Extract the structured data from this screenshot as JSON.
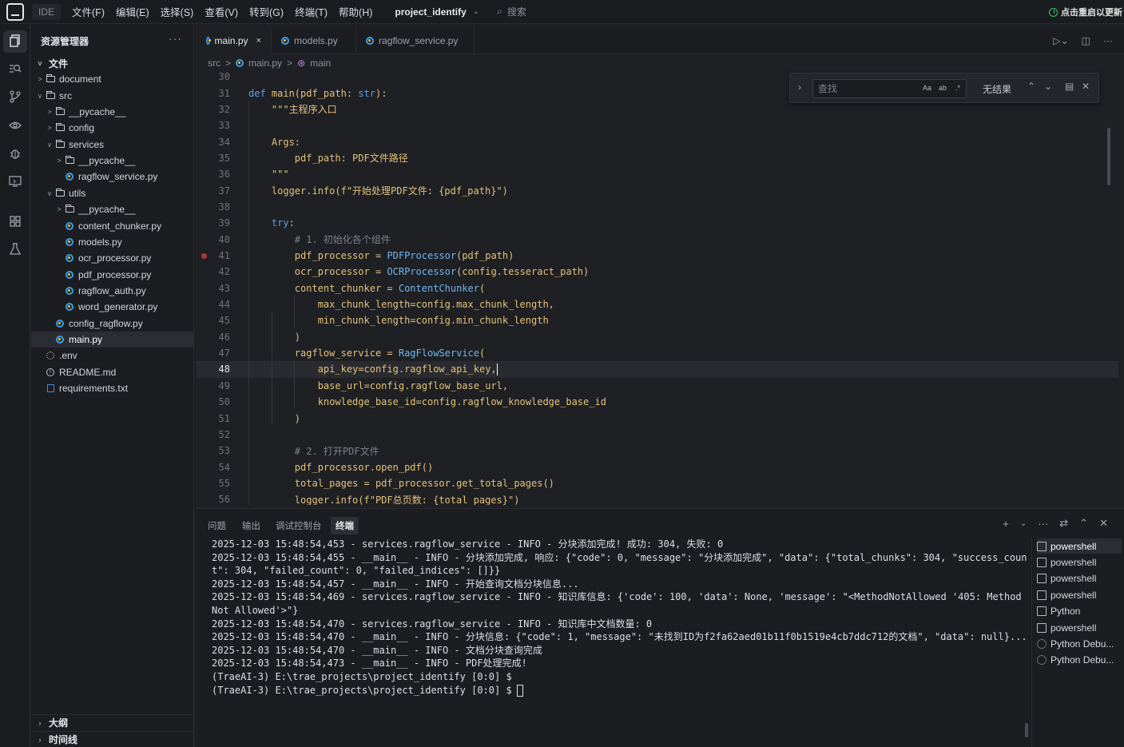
{
  "titlebar": {
    "ide_label": "IDE",
    "menus": [
      "文件(F)",
      "编辑(E)",
      "选择(S)",
      "查看(V)",
      "转到(G)",
      "终端(T)",
      "帮助(H)"
    ],
    "project": "project_identify",
    "search_placeholder": "搜索",
    "update_hint": "点击重启以更新"
  },
  "sidebar": {
    "title": "资源管理器",
    "more": "···",
    "tree": [
      {
        "label": "文件",
        "type": "section",
        "depth": 0,
        "twisty": "v"
      },
      {
        "label": "document",
        "type": "folder",
        "depth": 0,
        "twisty": ">"
      },
      {
        "label": "src",
        "type": "folder-open",
        "depth": 0,
        "twisty": "v"
      },
      {
        "label": "__pycache__",
        "type": "folder",
        "depth": 1,
        "twisty": ">"
      },
      {
        "label": "config",
        "type": "folder",
        "depth": 1,
        "twisty": ">"
      },
      {
        "label": "services",
        "type": "folder-open",
        "depth": 1,
        "twisty": "v"
      },
      {
        "label": "__pycache__",
        "type": "folder",
        "depth": 2,
        "twisty": ">"
      },
      {
        "label": "ragflow_service.py",
        "type": "py",
        "depth": 2,
        "twisty": ""
      },
      {
        "label": "utils",
        "type": "folder-open",
        "depth": 1,
        "twisty": "v"
      },
      {
        "label": "__pycache__",
        "type": "folder",
        "depth": 2,
        "twisty": ">"
      },
      {
        "label": "content_chunker.py",
        "type": "py",
        "depth": 2,
        "twisty": ""
      },
      {
        "label": "models.py",
        "type": "py",
        "depth": 2,
        "twisty": ""
      },
      {
        "label": "ocr_processor.py",
        "type": "py",
        "depth": 2,
        "twisty": ""
      },
      {
        "label": "pdf_processor.py",
        "type": "py",
        "depth": 2,
        "twisty": ""
      },
      {
        "label": "ragflow_auth.py",
        "type": "py",
        "depth": 2,
        "twisty": ""
      },
      {
        "label": "word_generator.py",
        "type": "py",
        "depth": 2,
        "twisty": ""
      },
      {
        "label": "config_ragflow.py",
        "type": "py",
        "depth": 1,
        "twisty": ""
      },
      {
        "label": "main.py",
        "type": "py",
        "depth": 1,
        "twisty": "",
        "selected": true
      },
      {
        "label": ".env",
        "type": "gear",
        "depth": 0,
        "twisty": ""
      },
      {
        "label": "README.md",
        "type": "info",
        "depth": 0,
        "twisty": ""
      },
      {
        "label": "requirements.txt",
        "type": "txt",
        "depth": 0,
        "twisty": ""
      }
    ],
    "footer": [
      "大纲",
      "时间线"
    ]
  },
  "tabs": [
    {
      "label": "main.py",
      "active": true,
      "close": "×"
    },
    {
      "label": "models.py",
      "active": false
    },
    {
      "label": "ragflow_service.py",
      "active": false
    }
  ],
  "breadcrumb": [
    "src",
    ">",
    "main.py",
    ">",
    "main"
  ],
  "find": {
    "placeholder": "查找",
    "opt_case": "Aa",
    "opt_word": "ab",
    "opt_regex": ".*",
    "result": "无结果"
  },
  "code": {
    "current_line": 48,
    "breakpoint_line": 41,
    "lines": [
      {
        "n": "30",
        "t": ""
      },
      {
        "n": "31",
        "t": "def main(pdf_path: str):"
      },
      {
        "n": "32",
        "t": "    \"\"\"主程序入口"
      },
      {
        "n": "33",
        "t": ""
      },
      {
        "n": "34",
        "t": "    Args:"
      },
      {
        "n": "35",
        "t": "        pdf_path: PDF文件路径"
      },
      {
        "n": "36",
        "t": "    \"\"\""
      },
      {
        "n": "37",
        "t": "    logger.info(f\"开始处理PDF文件: {pdf_path}\")"
      },
      {
        "n": "38",
        "t": ""
      },
      {
        "n": "39",
        "t": "    try:"
      },
      {
        "n": "40",
        "t": "        # 1. 初始化各个组件"
      },
      {
        "n": "41",
        "t": "        pdf_processor = PDFProcessor(pdf_path)"
      },
      {
        "n": "42",
        "t": "        ocr_processor = OCRProcessor(config.tesseract_path)"
      },
      {
        "n": "43",
        "t": "        content_chunker = ContentChunker("
      },
      {
        "n": "44",
        "t": "            max_chunk_length=config.max_chunk_length,"
      },
      {
        "n": "45",
        "t": "            min_chunk_length=config.min_chunk_length"
      },
      {
        "n": "46",
        "t": "        )"
      },
      {
        "n": "47",
        "t": "        ragflow_service = RagFlowService("
      },
      {
        "n": "48",
        "t": "            api_key=config.ragflow_api_key,"
      },
      {
        "n": "49",
        "t": "            base_url=config.ragflow_base_url,"
      },
      {
        "n": "50",
        "t": "            knowledge_base_id=config.ragflow_knowledge_base_id"
      },
      {
        "n": "51",
        "t": "        )"
      },
      {
        "n": "52",
        "t": ""
      },
      {
        "n": "53",
        "t": "        # 2. 打开PDF文件"
      },
      {
        "n": "54",
        "t": "        pdf_processor.open_pdf()"
      },
      {
        "n": "55",
        "t": "        total_pages = pdf_processor.get_total_pages()"
      },
      {
        "n": "56",
        "t": "        logger.info(f\"PDF总页数: {total_pages}\")"
      }
    ]
  },
  "panel": {
    "tabs": [
      "问题",
      "输出",
      "调试控制台",
      "终端"
    ],
    "active_tab": "终端",
    "terminal_lines": [
      "2025-12-03 15:48:54,453 - services.ragflow_service - INFO - 分块添加完成! 成功: 304, 失败: 0",
      "2025-12-03 15:48:54,455 - __main__ - INFO - 分块添加完成, 响应: {\"code\": 0, \"message\": \"分块添加完成\", \"data\": {\"total_chunks\": 304, \"success_count\": 304, \"failed_count\": 0, \"failed_indices\": []}}",
      "2025-12-03 15:48:54,457 - __main__ - INFO - 开始查询文档分块信息...",
      "2025-12-03 15:48:54,469 - services.ragflow_service - INFO - 知识库信息: {'code': 100, 'data': None, 'message': \"<MethodNotAllowed '405: Method Not Allowed'>\"}",
      "2025-12-03 15:48:54,470 - services.ragflow_service - INFO - 知识库中文档数量: 0",
      "2025-12-03 15:48:54,470 - __main__ - INFO - 分块信息: {\"code\": 1, \"message\": \"未找到ID为f2fa62aed01b11f0b1519e4cb7ddc712的文档\", \"data\": null}...",
      "2025-12-03 15:48:54,470 - __main__ - INFO - 文档分块查询完成",
      "2025-12-03 15:48:54,473 - __main__ - INFO - PDF处理完成!",
      "(TraeAI-3) E:\\trae_projects\\project_identify [0:0] $",
      "(TraeAI-3) E:\\trae_projects\\project_identify [0:0] $"
    ],
    "terminals": [
      {
        "label": "powershell",
        "kind": "shell",
        "active": true
      },
      {
        "label": "powershell",
        "kind": "shell"
      },
      {
        "label": "powershell",
        "kind": "shell"
      },
      {
        "label": "powershell",
        "kind": "shell"
      },
      {
        "label": "Python",
        "kind": "shell"
      },
      {
        "label": "powershell",
        "kind": "shell"
      },
      {
        "label": "Python Debu...",
        "kind": "debug"
      },
      {
        "label": "Python Debu...",
        "kind": "debug"
      }
    ]
  },
  "colors": {
    "background": "#1f2024",
    "keyword": "#5aa0e6",
    "function": "#e3c27a",
    "string": "#e3c27a",
    "comment": "#7b8088",
    "cursor_line": "#2a2b30",
    "breakpoint": "#a93a3a",
    "update_icon": "#3fc06b"
  }
}
